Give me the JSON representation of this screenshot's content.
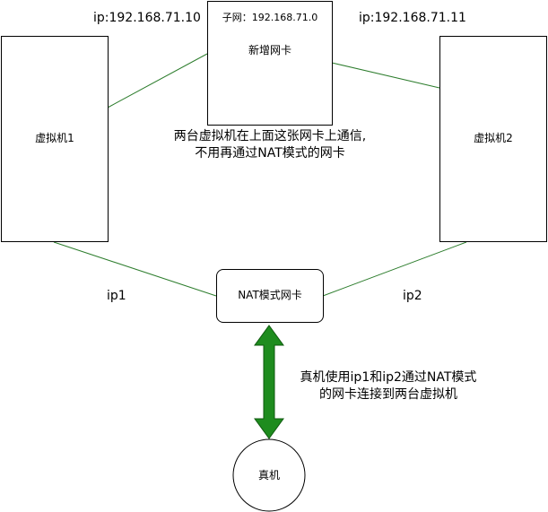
{
  "nodes": {
    "vm1": {
      "label": "虚拟机1",
      "ip": "ip:192.168.71.10"
    },
    "vm2": {
      "label": "虚拟机2",
      "ip": "ip:192.168.71.11"
    },
    "new_nic": {
      "subnet": "子网：192.168.71.0",
      "label": "新增网卡"
    },
    "nat_nic": {
      "label": "NAT模式网卡"
    },
    "host": {
      "label": "真机"
    }
  },
  "edge_labels": {
    "ip1": "ip1",
    "ip2": "ip2"
  },
  "notes": {
    "top_line1": "两台虚拟机在上面这张网卡上通信,",
    "top_line2": "不用再通过NAT模式的网卡",
    "bottom_line1": "真机使用ip1和ip2通过NAT模式",
    "bottom_line2": "的网卡连接到两台虚拟机"
  },
  "colors": {
    "connector_line": "#2d7d2d",
    "arrow_fill": "#1e8c1e",
    "box_border": "#000000"
  }
}
